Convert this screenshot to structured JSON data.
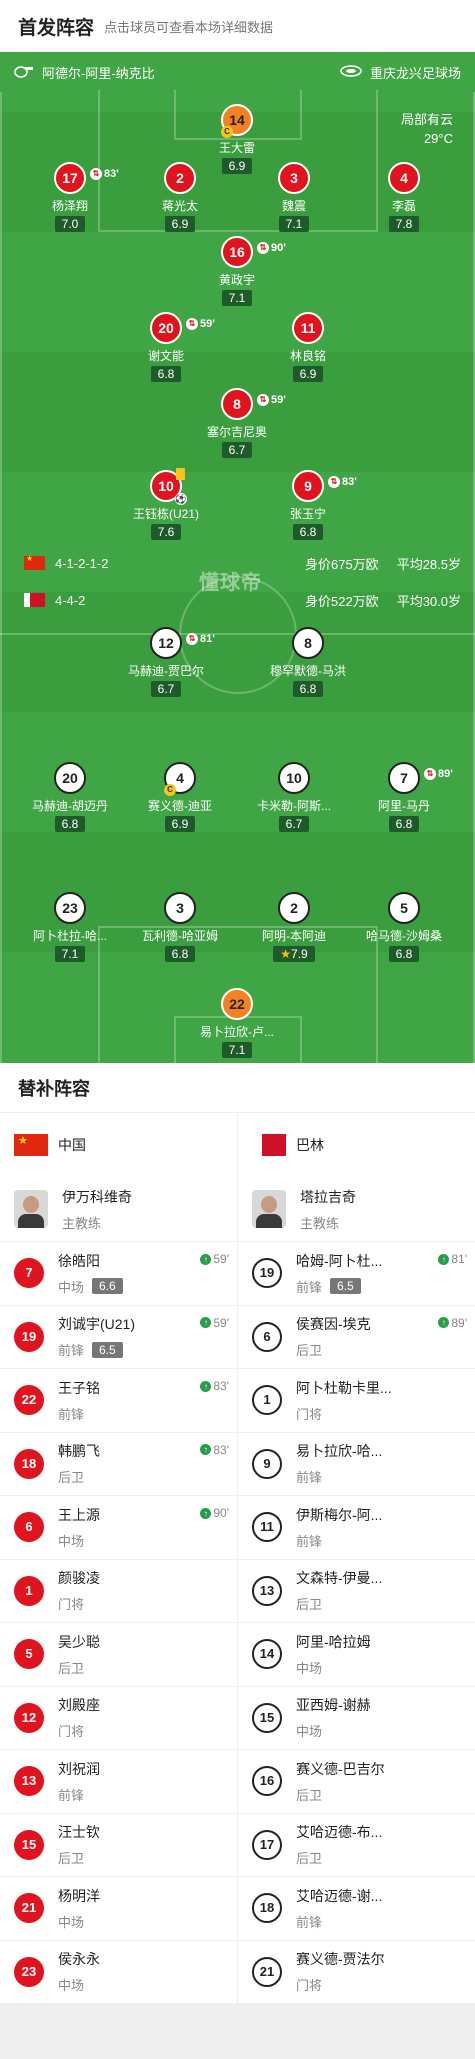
{
  "header": {
    "title": "首发阵容",
    "subtitle": "点击球员可查看本场详细数据"
  },
  "match": {
    "referee": "阿德尔-阿里-纳克比",
    "venue": "重庆龙兴足球场",
    "weather": "局部有云",
    "temperature": "29°C",
    "watermark": "懂球帝"
  },
  "home_team": {
    "formation": "4-1-2-1-2",
    "value": "身价675万欧",
    "age": "平均28.5岁"
  },
  "away_team": {
    "formation": "4-4-2",
    "value": "身价522万欧",
    "age": "平均30.0岁"
  },
  "home_players": [
    {
      "num": "14",
      "name": "王大雷",
      "rating": "6.9",
      "captain": "C"
    },
    {
      "num": "17",
      "name": "杨泽翔",
      "rating": "7.0",
      "sub": "83'"
    },
    {
      "num": "2",
      "name": "蒋光太",
      "rating": "6.9"
    },
    {
      "num": "3",
      "name": "魏震",
      "rating": "7.1"
    },
    {
      "num": "4",
      "name": "李磊",
      "rating": "7.8"
    },
    {
      "num": "16",
      "name": "黄政宇",
      "rating": "7.1",
      "sub": "90'"
    },
    {
      "num": "20",
      "name": "谢文能",
      "rating": "6.8",
      "sub": "59'"
    },
    {
      "num": "11",
      "name": "林良铭",
      "rating": "6.9"
    },
    {
      "num": "8",
      "name": "塞尔吉尼奥",
      "rating": "6.7",
      "sub": "59'"
    },
    {
      "num": "10",
      "name": "王钰栋(U21)",
      "rating": "7.6"
    },
    {
      "num": "9",
      "name": "张玉宁",
      "rating": "6.8",
      "sub": "83'"
    }
  ],
  "away_players": [
    {
      "num": "12",
      "name": "马赫迪-贾巴尔",
      "rating": "6.7",
      "sub": "81'"
    },
    {
      "num": "8",
      "name": "穆罕默德-马洪",
      "rating": "6.8"
    },
    {
      "num": "20",
      "name": "马赫迪-胡迈丹",
      "rating": "6.8"
    },
    {
      "num": "4",
      "name": "赛义德-迪亚",
      "rating": "6.9",
      "captain": "C"
    },
    {
      "num": "10",
      "name": "卡米勒-阿斯...",
      "rating": "6.7"
    },
    {
      "num": "7",
      "name": "阿里-马丹",
      "rating": "6.8",
      "sub": "89'"
    },
    {
      "num": "23",
      "name": "阿卜杜拉-哈...",
      "rating": "7.1"
    },
    {
      "num": "3",
      "name": "瓦利德-哈亚姆",
      "rating": "6.8"
    },
    {
      "num": "2",
      "name": "阿明-本阿迪",
      "rating": "7.9",
      "star": "★"
    },
    {
      "num": "5",
      "name": "哈马德-沙姆桑",
      "rating": "6.8"
    },
    {
      "num": "22",
      "name": "易卜拉欣-卢...",
      "rating": "7.1"
    }
  ],
  "subs": {
    "title": "替补阵容",
    "home": {
      "team": "中国",
      "coach": {
        "name": "伊万科维奇",
        "role": "主教练"
      },
      "players": [
        {
          "num": "7",
          "name": "徐皓阳",
          "pos": "中场",
          "rating": "6.6",
          "in": "59'"
        },
        {
          "num": "19",
          "name": "刘诚宇(U21)",
          "pos": "前锋",
          "rating": "6.5",
          "in": "59'"
        },
        {
          "num": "22",
          "name": "王子铭",
          "pos": "前锋",
          "in": "83'"
        },
        {
          "num": "18",
          "name": "韩鹏飞",
          "pos": "后卫",
          "in": "83'"
        },
        {
          "num": "6",
          "name": "王上源",
          "pos": "中场",
          "in": "90'"
        },
        {
          "num": "1",
          "name": "颜骏凌",
          "pos": "门将"
        },
        {
          "num": "5",
          "name": "吴少聪",
          "pos": "后卫"
        },
        {
          "num": "12",
          "name": "刘殿座",
          "pos": "门将"
        },
        {
          "num": "13",
          "name": "刘祝润",
          "pos": "前锋"
        },
        {
          "num": "15",
          "name": "汪士钦",
          "pos": "后卫"
        },
        {
          "num": "21",
          "name": "杨明洋",
          "pos": "中场"
        },
        {
          "num": "23",
          "name": "侯永永",
          "pos": "中场"
        }
      ]
    },
    "away": {
      "team": "巴林",
      "coach": {
        "name": "塔拉吉奇",
        "role": "主教练"
      },
      "players": [
        {
          "num": "19",
          "name": "哈姆-阿卜杜...",
          "pos": "前锋",
          "rating": "6.5",
          "in": "81'"
        },
        {
          "num": "6",
          "name": "侯赛因-埃克",
          "pos": "后卫",
          "in": "89'"
        },
        {
          "num": "1",
          "name": "阿卜杜勒卡里...",
          "pos": "门将"
        },
        {
          "num": "9",
          "name": "易卜拉欣-哈...",
          "pos": "前锋"
        },
        {
          "num": "11",
          "name": "伊斯梅尔-阿...",
          "pos": "前锋"
        },
        {
          "num": "13",
          "name": "文森特-伊曼...",
          "pos": "后卫"
        },
        {
          "num": "14",
          "name": "阿里-哈拉姆",
          "pos": "中场"
        },
        {
          "num": "15",
          "name": "亚西姆-谢赫",
          "pos": "中场"
        },
        {
          "num": "16",
          "name": "赛义德-巴吉尔",
          "pos": "后卫"
        },
        {
          "num": "17",
          "name": "艾哈迈德-布...",
          "pos": "后卫"
        },
        {
          "num": "18",
          "name": "艾哈迈德-谢...",
          "pos": "前锋"
        },
        {
          "num": "21",
          "name": "赛义德-贾法尔",
          "pos": "门将"
        }
      ]
    }
  }
}
